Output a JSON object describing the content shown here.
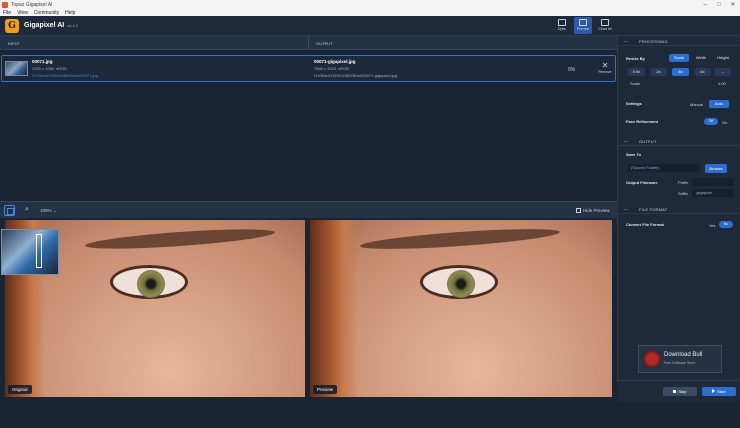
{
  "window": {
    "title": "Topaz Gigapixel AI",
    "min": "–",
    "max": "□",
    "close": "✕"
  },
  "menu": [
    "File",
    "View",
    "Community",
    "Help"
  ],
  "header": {
    "brand": "Gigapixel AI",
    "version": "v6.4.2",
    "logo_letter": "G",
    "buttons": [
      {
        "label": "Open",
        "icon": "folder-icon"
      },
      {
        "label": "Preview",
        "icon": "split-view-icon",
        "active": true
      },
      {
        "label": "Close All",
        "icon": "close-all-icon"
      }
    ]
  },
  "list": {
    "col_input": "INPUT",
    "col_output": "OUTPUT",
    "file": {
      "name": "00071.jpg",
      "meta": "1920 x 1080, sRGB",
      "path": "H:/Other/1920x1080/Other/00071.jpg",
      "out_name": "00071-gigapixel.jpg",
      "out_meta": "7680 x 4320, sRGB",
      "out_path": "H:/Other/1920x1080/Other/00071-gigapixel.jpg",
      "progress": "0%",
      "remove_label": "Remove"
    }
  },
  "preview_bar": {
    "zoom": "100%",
    "hide_label": "Hide Preview"
  },
  "panes": {
    "original_label": "Original",
    "preview_label": "Preview"
  },
  "panel": {
    "processing": {
      "title": "PROCESSING",
      "resize_by_label": "Resize By",
      "resize_options": [
        "Scale",
        "Width",
        "Height"
      ],
      "scale_options": [
        "0.5x",
        "2x",
        "4x",
        "6x",
        "→"
      ],
      "scale_label": "Scale",
      "scale_value": "4.00",
      "settings_label": "Settings",
      "settings_options": [
        "Manual",
        "Auto"
      ],
      "face_label": "Face Refinement",
      "face_options": [
        "Off",
        "On"
      ]
    },
    "output": {
      "title": "OUTPUT",
      "save_to_label": "Save To",
      "save_to_value": "(Source Folder)",
      "browse": "Browse",
      "filename_label": "Output Filename",
      "prefix_label": "Prefix",
      "suffix_label": "Suffix",
      "suffix_value": "-gigapixel"
    },
    "format": {
      "title": "FILE FORMAT",
      "convert_label": "Convert File Format",
      "options": [
        "Yes",
        "No"
      ]
    },
    "stop": "Stop",
    "start": "Start"
  },
  "watermark": {
    "title": "Download Bull",
    "subtitle": "Free Software Store"
  },
  "colors": {
    "accent": "#2c6fd0",
    "logo": "#f39a1f",
    "panel": "#1e2a3a"
  }
}
